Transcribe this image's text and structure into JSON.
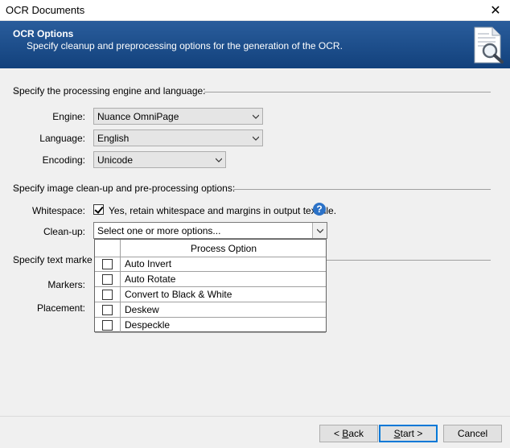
{
  "window": {
    "title": "OCR Documents",
    "close_glyph": "✕"
  },
  "banner": {
    "title": "OCR Options",
    "subtitle": "Specify cleanup and preprocessing options for the generation of the OCR.",
    "icon": "document-magnifier-icon"
  },
  "engine_section": {
    "heading": "Specify the processing engine and language:",
    "engine_label": "Engine:",
    "engine_value": "Nuance OmniPage",
    "language_label": "Language:",
    "language_value": "English",
    "encoding_label": "Encoding:",
    "encoding_value": "Unicode"
  },
  "cleanup_section": {
    "heading": "Specify image clean-up and pre-processing options:",
    "whitespace_label": "Whitespace:",
    "whitespace_checked": true,
    "whitespace_text": "Yes, retain whitespace and margins in output text file.",
    "help_glyph": "?",
    "cleanup_label": "Clean-up:",
    "cleanup_placeholder": "Select one or more options..."
  },
  "text_section": {
    "heading_partial": "Specify text marke",
    "markers_label": "Markers:",
    "placement_label": "Placement:"
  },
  "dropdown": {
    "header": "Process Option",
    "options": [
      {
        "label": "Auto Invert",
        "checked": false
      },
      {
        "label": "Auto Rotate",
        "checked": false
      },
      {
        "label": "Convert to Black & White",
        "checked": false
      },
      {
        "label": "Deskew",
        "checked": false
      },
      {
        "label": "Despeckle",
        "checked": false
      }
    ]
  },
  "buttons": {
    "back_prefix": "< ",
    "back_mnemonic": "B",
    "back_rest": "ack",
    "start_mnemonic": "S",
    "start_rest": "tart >",
    "cancel": "Cancel"
  },
  "colors": {
    "banner": "#1b4f8f",
    "accent": "#0078d7",
    "help": "#2c72c7"
  }
}
